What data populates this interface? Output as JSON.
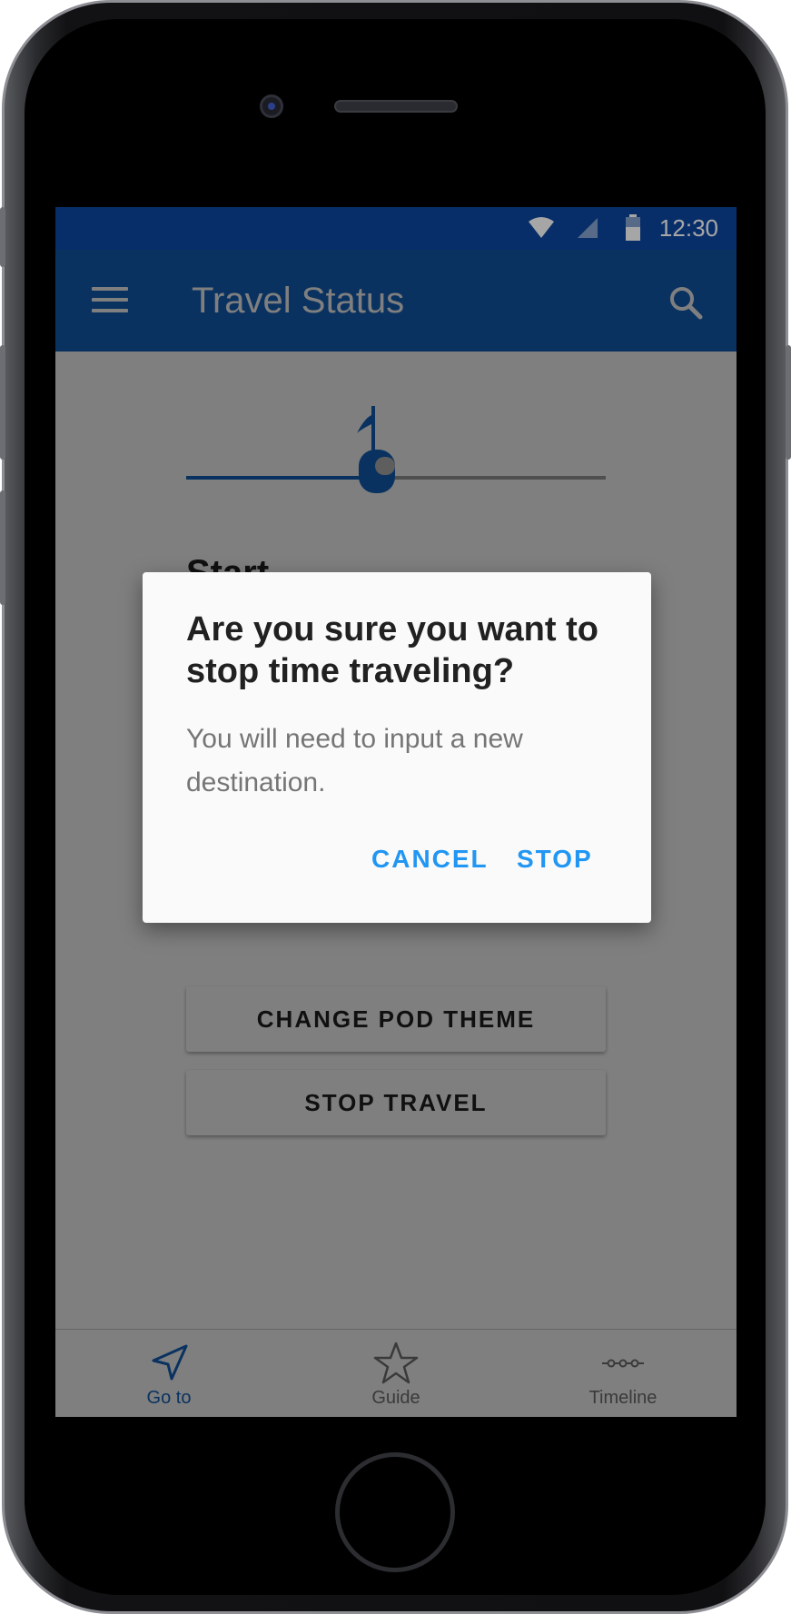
{
  "status_bar": {
    "time": "12:30"
  },
  "app_bar": {
    "title": "Travel Status"
  },
  "travel": {
    "progress": 0.45,
    "start_label": "Start"
  },
  "actions": {
    "change_theme": "CHANGE POD THEME",
    "stop_travel": "STOP TRAVEL"
  },
  "dialog": {
    "title": "Are you sure you want to stop time traveling?",
    "body": "You will need to input a new destination.",
    "cancel": "CANCEL",
    "confirm": "STOP"
  },
  "bottom_nav": {
    "items": [
      {
        "label": "Go to",
        "icon": "navigation-arrow-icon",
        "active": true
      },
      {
        "label": "Guide",
        "icon": "star-icon",
        "active": false
      },
      {
        "label": "Timeline",
        "icon": "timeline-icon",
        "active": false
      }
    ]
  },
  "colors": {
    "primary": "#1565c0",
    "primary_dark": "#0d47a1",
    "accent": "#2196f3"
  }
}
